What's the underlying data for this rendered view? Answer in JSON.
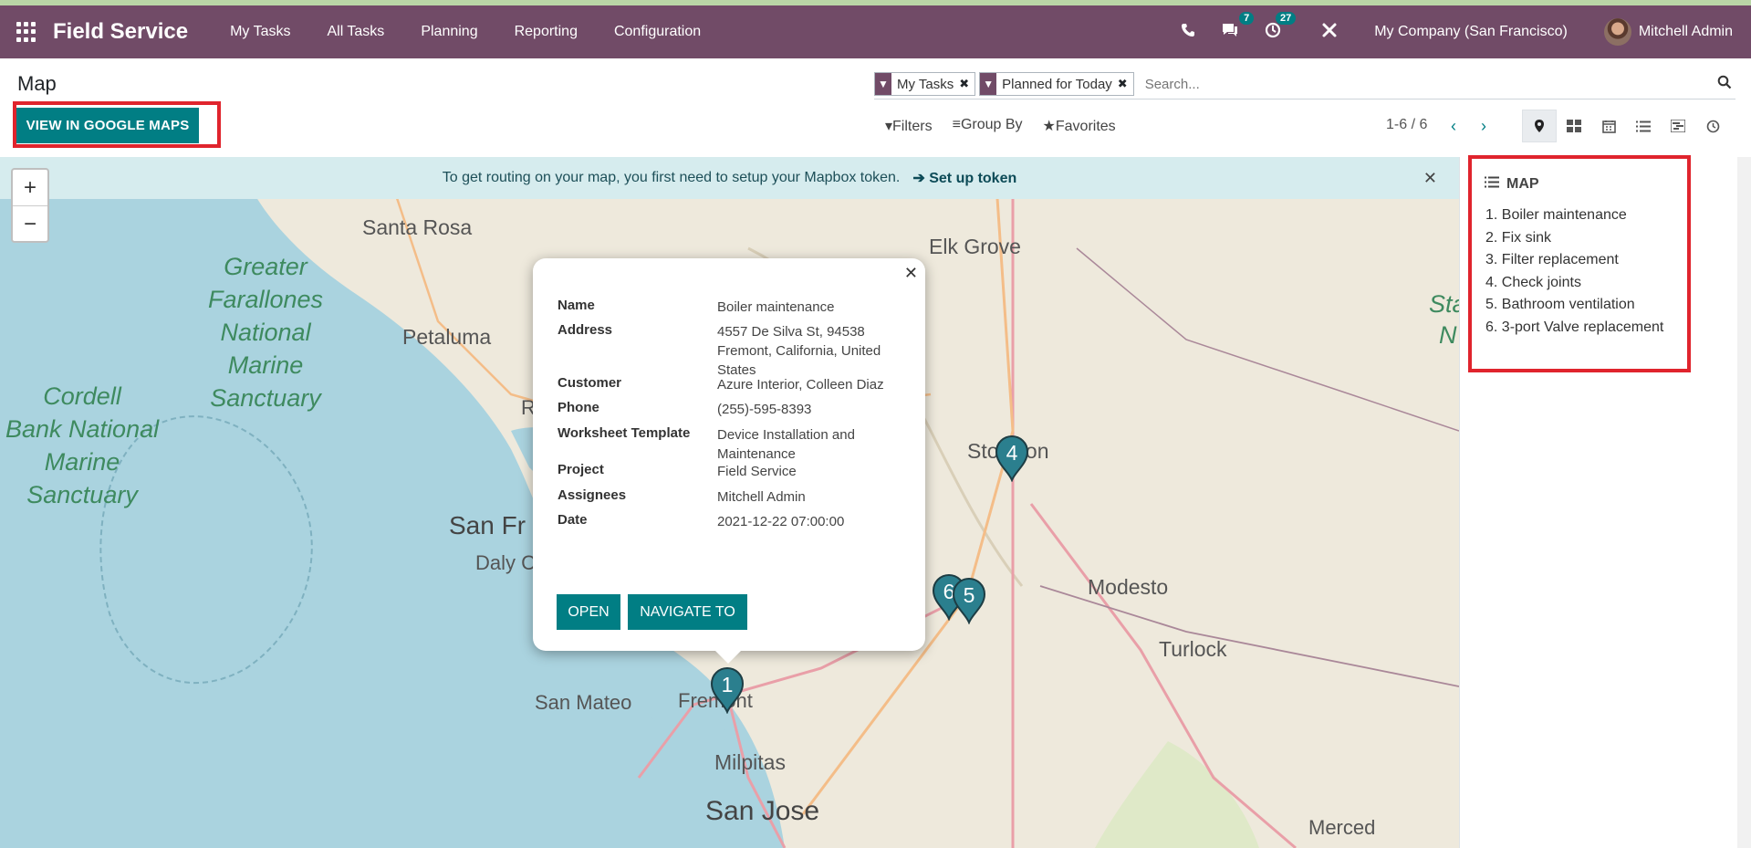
{
  "navbar": {
    "app_name": "Field Service",
    "menu": [
      "My Tasks",
      "All Tasks",
      "Planning",
      "Reporting",
      "Configuration"
    ],
    "messages_badge": "7",
    "activities_badge": "27",
    "company": "My Company (San Francisco)",
    "user": "Mitchell Admin"
  },
  "page": {
    "title": "Map",
    "google_maps_button": "VIEW IN GOOGLE MAPS"
  },
  "search": {
    "facets": [
      "My Tasks",
      "Planned for Today"
    ],
    "placeholder": "Search..."
  },
  "filters": {
    "filters_label": "Filters",
    "groupby_label": "Group By",
    "favorites_label": "Favorites"
  },
  "pager": {
    "value": "1-6 / 6"
  },
  "banner": {
    "text": "To get routing on your map, you first need to setup your Mapbox token.",
    "link": "Set up token"
  },
  "map_labels": {
    "santa_rosa": "Santa Rosa",
    "petaluma": "Petaluma",
    "elk_grove": "Elk Grove",
    "stockton": "Stockton",
    "modesto": "Modesto",
    "turlock": "Turlock",
    "san_francisco": "San Fr",
    "daly_city": "Daly C",
    "san_mateo": "San Mateo",
    "fremont": "Fremont",
    "milpitas": "Milpitas",
    "san_jose": "San Jose",
    "merced": "Merced",
    "sanctuary_1": "Greater\nFarallones\nNational\nMarine\nSanctuary",
    "sanctuary_2": "Cordell\nBank National\nMarine\nSanctuary",
    "edge_1": "Sta",
    "edge_2": "N",
    "edge_3": "R"
  },
  "popup": {
    "rows": [
      {
        "key": "Name",
        "value": "Boiler maintenance"
      },
      {
        "key": "Address",
        "value": "4557 De Silva St, 94538 Fremont, California, United States"
      },
      {
        "key": "Customer",
        "value": "Azure Interior, Colleen Diaz"
      },
      {
        "key": "Phone",
        "value": "(255)-595-8393"
      },
      {
        "key": "Worksheet Template",
        "value": "Device Installation and Maintenance"
      },
      {
        "key": "Project",
        "value": "Field Service"
      },
      {
        "key": "Assignees",
        "value": "Mitchell Admin"
      },
      {
        "key": "Date",
        "value": "2021-12-22 07:00:00"
      }
    ],
    "open_label": "OPEN",
    "navigate_label": "NAVIGATE TO"
  },
  "markers": [
    "1",
    "4",
    "6",
    "5"
  ],
  "sidebar": {
    "title": "MAP",
    "items": [
      "1. Boiler maintenance",
      "2. Fix sink",
      "3. Filter replacement",
      "4. Check joints",
      "5. Bathroom ventilation",
      "6. 3-port Valve replacement"
    ]
  },
  "colors": {
    "brand": "#714b67",
    "accent": "#017e84",
    "highlight": "#e0242d"
  }
}
